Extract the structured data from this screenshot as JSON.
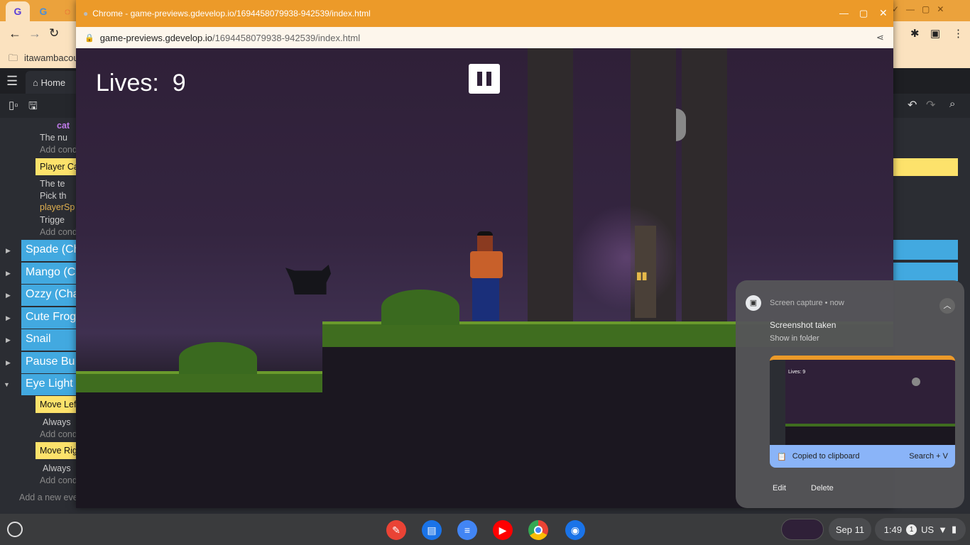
{
  "background_browser": {
    "bookmark": "itawambacoun",
    "gdevelop_tab": "Home"
  },
  "events": {
    "cat_condition": "cat",
    "var_text_1": "The nu",
    "add_condition": "Add conditi",
    "player_cat": "Player Ca",
    "var_text_2": "The te",
    "pick_text": "Pick th",
    "player_sprite": "playerSp",
    "trigger": "Trigge",
    "groups": [
      "Spade (Ch",
      "Mango (C",
      "Ozzy (Cha",
      "Cute Frog",
      "Snail",
      "Pause Bu",
      "Eye Light"
    ],
    "move_left": "Move Left",
    "always": "Always",
    "move_right": "Move Rig",
    "add_event": "Add a new eve"
  },
  "popup": {
    "title": "Chrome - game-previews.gdevelop.io/1694458079938-942539/index.html",
    "url_host": "game-previews.gdevelop.io",
    "url_path": "/1694458079938-942539/index.html"
  },
  "game": {
    "lives_label": "Lives:",
    "lives_value": "9",
    "paused": false
  },
  "notification": {
    "app": "Screen capture",
    "time": "now",
    "title": "Screenshot taken",
    "subtitle": "Show in folder",
    "copied": "Copied to clipboard",
    "shortcut": "Search + V",
    "edit": "Edit",
    "delete": "Delete"
  },
  "shelf": {
    "date": "Sep 11",
    "time": "1:49",
    "badge": "1",
    "ime": "US"
  },
  "colors": {
    "popup_titlebar": "#ec9a29",
    "gdevelop_blue": "#42a9e0",
    "gdevelop_yellow": "#fde26b",
    "clipboard_bar": "#8ab4f8"
  }
}
